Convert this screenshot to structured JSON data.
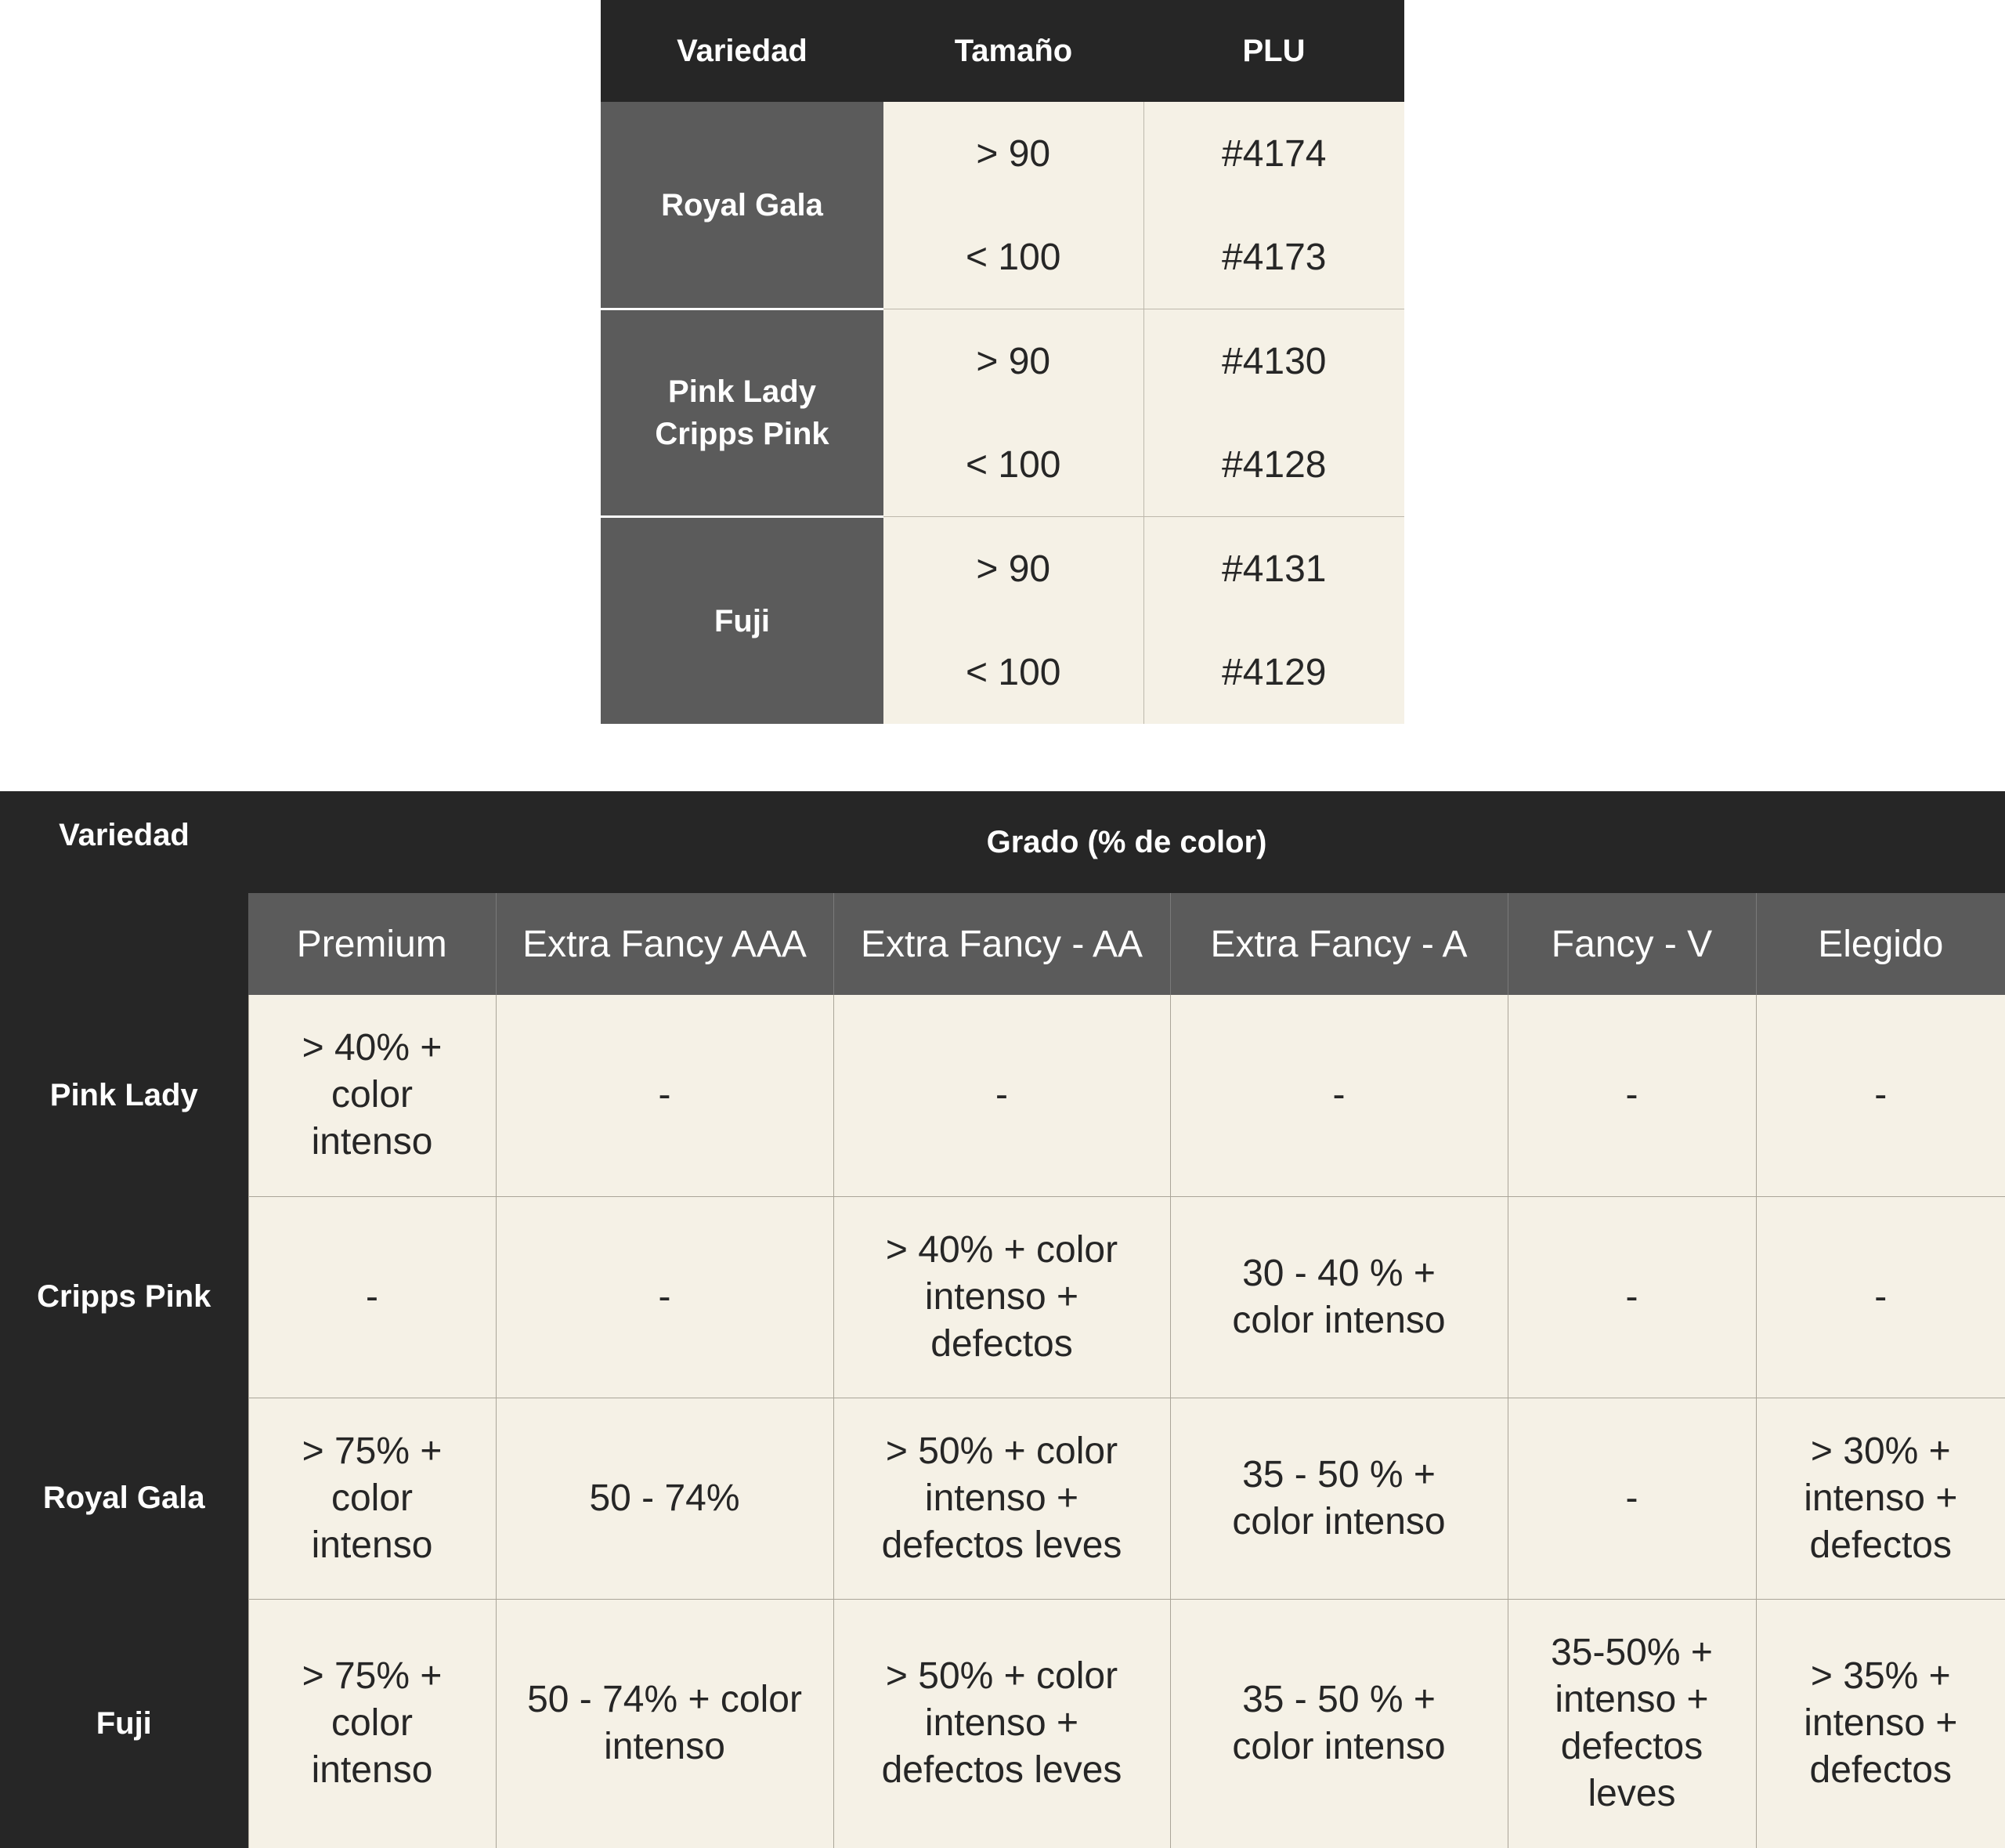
{
  "plu_table": {
    "headers": [
      "Variedad",
      "Tamaño",
      "PLU"
    ],
    "groups": [
      {
        "variety_lines": [
          "Royal Gala"
        ],
        "rows": [
          {
            "size": "> 90",
            "plu": "#4174"
          },
          {
            "size": "< 100",
            "plu": "#4173"
          }
        ]
      },
      {
        "variety_lines": [
          "Pink Lady",
          "Cripps Pink"
        ],
        "rows": [
          {
            "size": "> 90",
            "plu": "#4130"
          },
          {
            "size": "< 100",
            "plu": "#4128"
          }
        ]
      },
      {
        "variety_lines": [
          "Fuji"
        ],
        "rows": [
          {
            "size": "> 90",
            "plu": "#4131"
          },
          {
            "size": "< 100",
            "plu": "#4129"
          }
        ]
      }
    ]
  },
  "grade_table": {
    "variety_header": "Variedad",
    "group_header": "Grado (% de color)",
    "grades": [
      "Premium",
      "Extra Fancy AAA",
      "Extra Fancy - AA",
      "Extra Fancy - A",
      "Fancy - V",
      "Elegido"
    ],
    "rows": [
      {
        "variety": "Pink Lady",
        "cells": [
          "> 40% + color intenso",
          "-",
          "-",
          "-",
          "-",
          "-"
        ]
      },
      {
        "variety": "Cripps Pink",
        "cells": [
          "-",
          "-",
          "> 40% + color intenso + defectos",
          "30 - 40 % + color intenso",
          "-",
          "-"
        ]
      },
      {
        "variety": "Royal Gala",
        "cells": [
          "> 75% + color intenso",
          "50 - 74%",
          "> 50% + color intenso + defectos leves",
          "35 - 50 % + color intenso",
          "-",
          "> 30% + intenso + defectos"
        ]
      },
      {
        "variety": "Fuji",
        "cells": [
          "> 75% + color intenso",
          "50 - 74% + color intenso",
          "> 50% + color intenso + defectos leves",
          "35 - 50 % + color intenso",
          "35-50% + intenso + defectos leves",
          "> 35% + intenso + defectos"
        ]
      }
    ]
  }
}
